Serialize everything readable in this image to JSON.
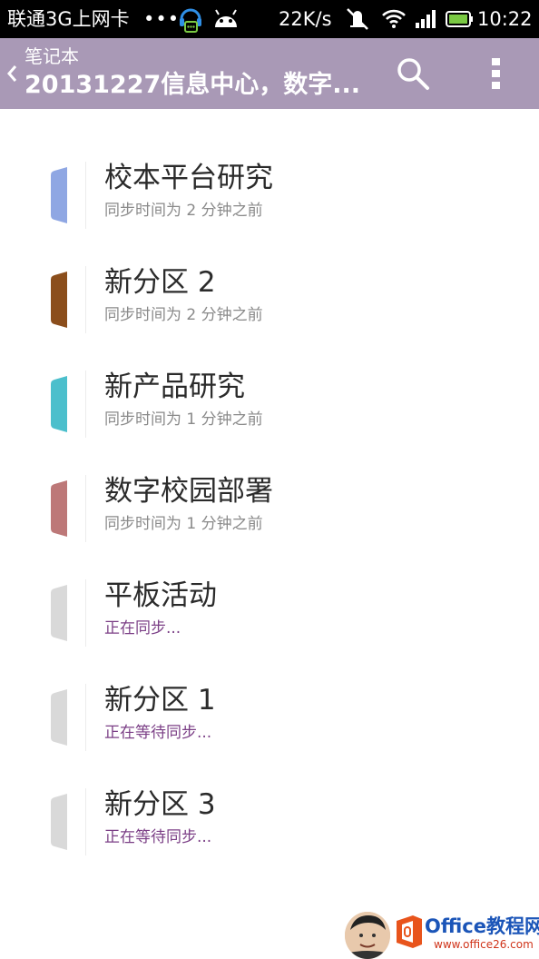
{
  "status_bar": {
    "carrier": "联通3G上网卡",
    "dots": "•••",
    "speed": "22K/s",
    "time": "10:22",
    "icons": [
      "headset-icon",
      "android-icon",
      "mute-icon",
      "wifi-icon",
      "signal-icon",
      "battery-icon"
    ]
  },
  "app_bar": {
    "breadcrumb": "笔记本",
    "title": "20131227信息中心，数字...",
    "icons": [
      "back-chevron-icon",
      "search-icon",
      "overflow-menu-icon"
    ]
  },
  "sections": [
    {
      "name": "校本平台研究",
      "status": "同步时间为 2 分钟之前",
      "tab_color": "#8fa7e3",
      "syncing": false
    },
    {
      "name": "新分区 2",
      "status": "同步时间为 2 分钟之前",
      "tab_color": "#8b4e1c",
      "syncing": false
    },
    {
      "name": "新产品研究",
      "status": "同步时间为 1 分钟之前",
      "tab_color": "#4bbfcc",
      "syncing": false
    },
    {
      "name": "数字校园部署",
      "status": "同步时间为 1 分钟之前",
      "tab_color": "#bd7878",
      "syncing": false
    },
    {
      "name": "平板活动",
      "status": "正在同步...",
      "tab_color": "#d9d9d9",
      "syncing": true
    },
    {
      "name": "新分区 1",
      "status": "正在等待同步...",
      "tab_color": "#d9d9d9",
      "syncing": true
    },
    {
      "name": "新分区 3",
      "status": "正在等待同步...",
      "tab_color": "#d9d9d9",
      "syncing": true
    }
  ],
  "watermark": {
    "brand": "Office教程网",
    "url": "www.office26.com"
  },
  "colors": {
    "app_bar": "#a999b6",
    "status_bar": "#000000",
    "syncing_text": "#7b3f86",
    "synced_text": "#8a8a8a"
  }
}
